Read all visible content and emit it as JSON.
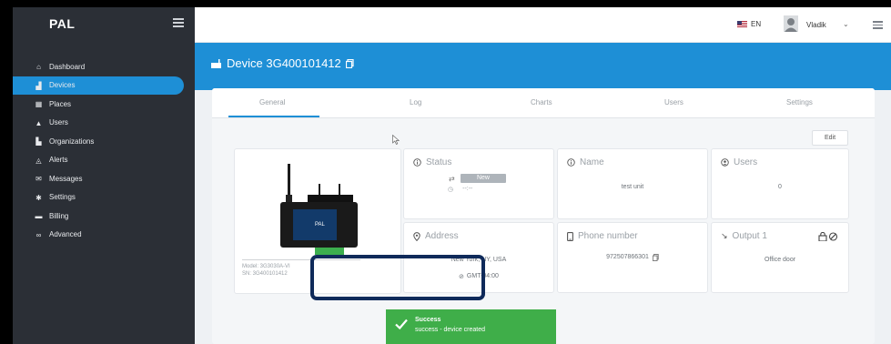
{
  "app": {
    "logo": "PAL"
  },
  "sidebar": {
    "items": [
      {
        "label": "Dashboard",
        "icon": "dashboard-icon",
        "glyph": "⌂"
      },
      {
        "label": "Devices",
        "icon": "devices-icon",
        "glyph": "▟",
        "active": true
      },
      {
        "label": "Places",
        "icon": "places-icon",
        "glyph": "▦"
      },
      {
        "label": "Users",
        "icon": "users-icon",
        "glyph": "▲"
      },
      {
        "label": "Organizations",
        "icon": "organizations-icon",
        "glyph": "▙"
      },
      {
        "label": "Alerts",
        "icon": "alerts-icon",
        "glyph": "◬"
      },
      {
        "label": "Messages",
        "icon": "messages-icon",
        "glyph": "✉"
      },
      {
        "label": "Settings",
        "icon": "settings-icon",
        "glyph": "✱"
      },
      {
        "label": "Billing",
        "icon": "billing-icon",
        "glyph": "▬"
      },
      {
        "label": "Advanced",
        "icon": "advanced-icon",
        "glyph": "∞"
      }
    ]
  },
  "topbar": {
    "language": "EN",
    "user_name": "Vladik",
    "chevron": "⌄"
  },
  "page": {
    "title": "Device 3G400101412"
  },
  "tabs": [
    {
      "label": "General",
      "active": true
    },
    {
      "label": "Log"
    },
    {
      "label": "Charts"
    },
    {
      "label": "Users"
    },
    {
      "label": "Settings"
    }
  ],
  "edit_label": "Edit",
  "device_image": {
    "model": "Model: 3G3030A-VI",
    "sn": "SN: 3G400101412",
    "device_label": "PAL"
  },
  "cards": {
    "status": {
      "title": "Status",
      "badge": "New",
      "time": "--:--"
    },
    "name": {
      "title": "Name",
      "value": "test unit"
    },
    "users": {
      "title": "Users",
      "value": "0"
    },
    "address": {
      "title": "Address",
      "value": "New York, NY, USA",
      "tz": "GMT-04:00"
    },
    "phone": {
      "title": "Phone number",
      "value": "972507866301"
    },
    "output": {
      "title": "Output 1",
      "value": "Office door"
    }
  },
  "toast": {
    "title": "Success",
    "message": "success - device created"
  },
  "colors": {
    "primary": "#1e8fd6",
    "sidebar": "#2b2f36",
    "success": "#3fae49",
    "highlight": "#0f2a5a"
  }
}
